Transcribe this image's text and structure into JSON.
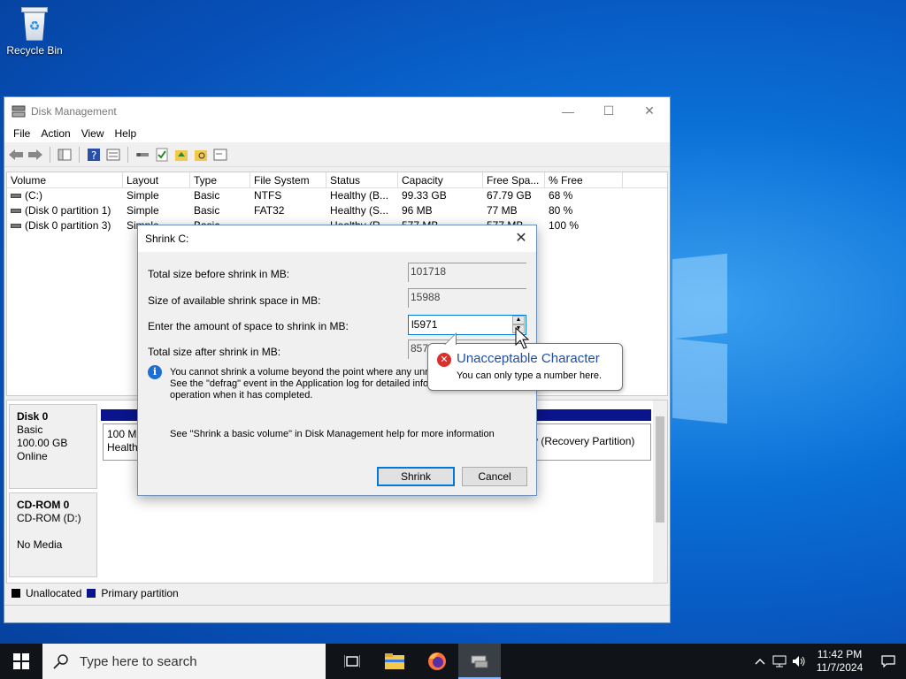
{
  "desktop": {
    "recycle_bin_label": "Recycle Bin"
  },
  "window": {
    "title": "Disk Management",
    "menu": [
      "File",
      "Action",
      "View",
      "Help"
    ],
    "columns": [
      "Volume",
      "Layout",
      "Type",
      "File System",
      "Status",
      "Capacity",
      "Free Spa...",
      "% Free"
    ],
    "rows": [
      [
        "(C:)",
        "Simple",
        "Basic",
        "NTFS",
        "Healthy (B...",
        "99.33 GB",
        "67.79 GB",
        "68 %"
      ],
      [
        "(Disk 0 partition 1)",
        "Simple",
        "Basic",
        "FAT32",
        "Healthy (S...",
        "96 MB",
        "77 MB",
        "80 %"
      ],
      [
        "(Disk 0 partition 3)",
        "Simple",
        "Basic",
        "",
        "Healthy (R...",
        "577 MB",
        "577 MB",
        "100 %"
      ]
    ],
    "disks": [
      {
        "name": "Disk 0",
        "line1": "Basic",
        "line2": "100.00 GB",
        "line3": "Online"
      },
      {
        "name": "CD-ROM 0",
        "line1": "CD-ROM (D:)",
        "line2": "",
        "line3": "No Media"
      }
    ],
    "partition_left": {
      "size": "100 MB",
      "status": "Healthy"
    },
    "partition_right": {
      "status": "y (Recovery Partition)"
    },
    "legend": [
      {
        "label": "Unallocated",
        "color": "#000000"
      },
      {
        "label": "Primary partition",
        "color": "#0a148c"
      }
    ]
  },
  "dialog": {
    "title": "Shrink C:",
    "fields": {
      "total_before_label": "Total size before shrink in MB:",
      "total_before_value": "101718",
      "available_label": "Size of available shrink space in MB:",
      "available_value": "15988",
      "amount_label": "Enter the amount of space to shrink in MB:",
      "amount_value": "l5971",
      "after_label": "Total size after shrink in MB:",
      "after_value": "857"
    },
    "info_lines": [
      "You cannot shrink a volume beyond the point where any unmo",
      "See the \"defrag\" event in the Application log for detailed infor",
      "operation when it has completed."
    ],
    "help_text": "See \"Shrink a basic volume\" in Disk Management help for more information",
    "shrink_button": "Shrink",
    "cancel_button": "Cancel"
  },
  "balloon": {
    "title": "Unacceptable Character",
    "body": "You can only type a number here."
  },
  "taskbar": {
    "search_placeholder": "Type here to search",
    "time": "11:42 PM",
    "date": "11/7/2024"
  },
  "colors": {
    "accent": "#0078d7",
    "taskbar": "#101418",
    "error": "#d9302c",
    "info": "#1e6fd1"
  }
}
